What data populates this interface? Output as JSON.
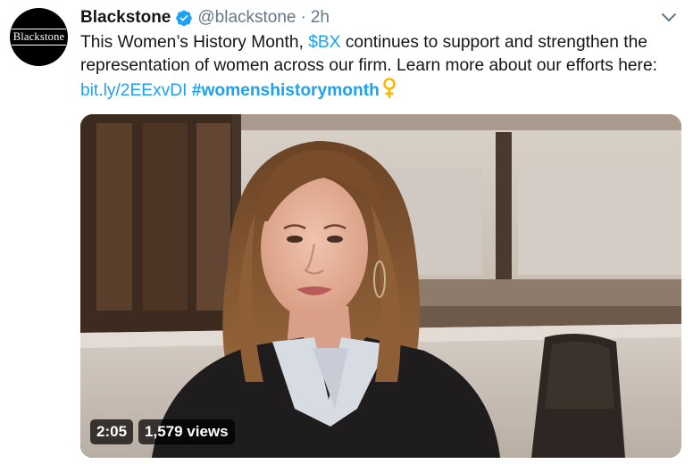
{
  "author": {
    "avatar_text": "Blackstone",
    "name": "Blackstone",
    "handle": "@blackstone",
    "separator": "·",
    "time": "2h",
    "verified": true
  },
  "tweet": {
    "text_part1": "This Women’s History Month, ",
    "cashtag": "$BX",
    "text_part2": " continues to support and strengthen the representation of women across our firm. Learn more about our efforts here: ",
    "link": "bit.ly/2EExvDI",
    "hashtag": "#womenshistorymonth",
    "emoji": "female-sign-icon"
  },
  "video": {
    "duration": "2:05",
    "views": "1,579 views"
  },
  "icons": {
    "verified": "verified-badge-icon",
    "menu": "chevron-down-icon"
  },
  "colors": {
    "accent": "#1da1f2",
    "text": "#14171a",
    "muted": "#657786",
    "emoji": "#f5b800"
  }
}
